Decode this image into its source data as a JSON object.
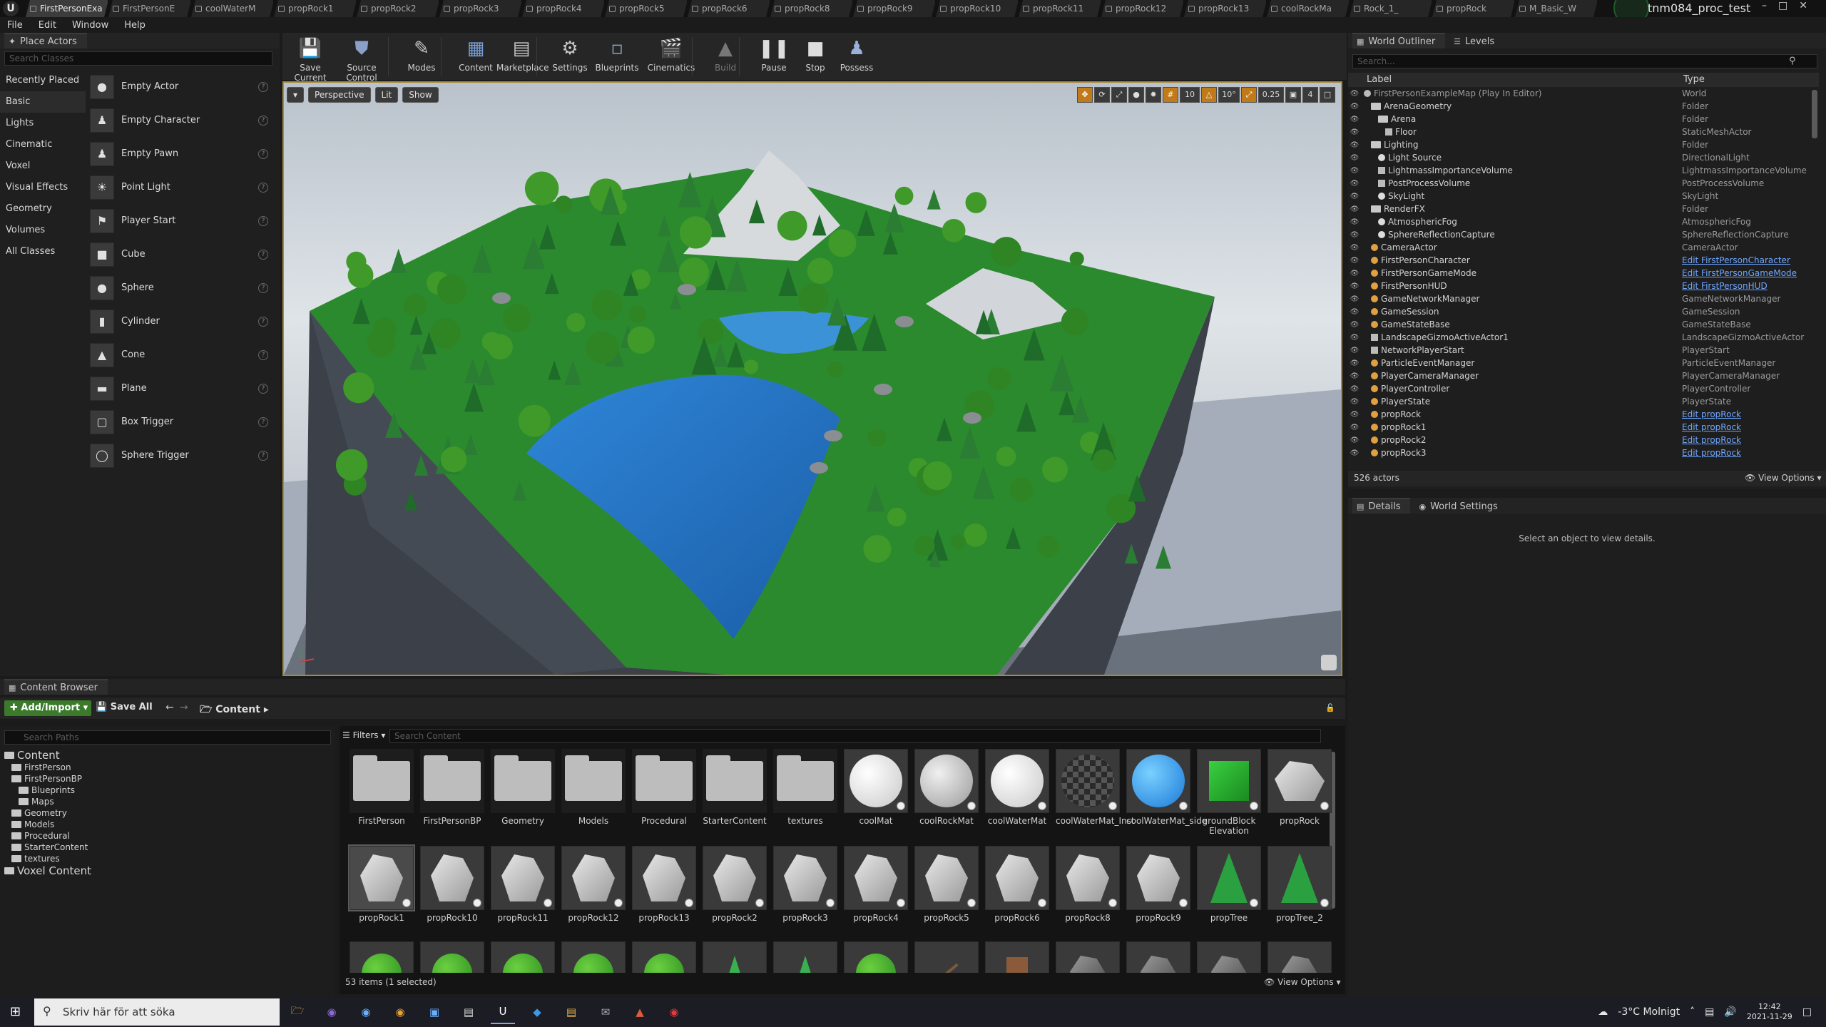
{
  "window": {
    "project": "tnm084_proc_test"
  },
  "tabs": [
    {
      "label": "FirstPersonExa",
      "active": true
    },
    {
      "label": "FirstPersonE"
    },
    {
      "label": "coolWaterM"
    },
    {
      "label": "propRock1"
    },
    {
      "label": "propRock2"
    },
    {
      "label": "propRock3"
    },
    {
      "label": "propRock4"
    },
    {
      "label": "propRock5"
    },
    {
      "label": "propRock6"
    },
    {
      "label": "propRock8"
    },
    {
      "label": "propRock9"
    },
    {
      "label": "propRock10"
    },
    {
      "label": "propRock11"
    },
    {
      "label": "propRock12"
    },
    {
      "label": "propRock13"
    },
    {
      "label": "coolRockMa"
    },
    {
      "label": "Rock_1_"
    },
    {
      "label": "propRock"
    },
    {
      "label": "M_Basic_W"
    }
  ],
  "menu": [
    "File",
    "Edit",
    "Window",
    "Help"
  ],
  "place_actors": {
    "title": "Place Actors",
    "search_placeholder": "Search Classes",
    "categories": [
      "Recently Placed",
      "Basic",
      "Lights",
      "Cinematic",
      "Voxel",
      "Visual Effects",
      "Geometry",
      "Volumes",
      "All Classes"
    ],
    "selected_category": "Basic",
    "actors": [
      "Empty Actor",
      "Empty Character",
      "Empty Pawn",
      "Point Light",
      "Player Start",
      "Cube",
      "Sphere",
      "Cylinder",
      "Cone",
      "Plane",
      "Box Trigger",
      "Sphere Trigger"
    ]
  },
  "toolbar": {
    "buttons": [
      {
        "label": "Save Current",
        "icon": "save-icon"
      },
      {
        "label": "Source Control",
        "icon": "source-control-icon"
      },
      {
        "label": "Modes",
        "icon": "modes-icon"
      },
      {
        "label": "Content",
        "icon": "content-icon"
      },
      {
        "label": "Marketplace",
        "icon": "marketplace-icon"
      },
      {
        "label": "Settings",
        "icon": "settings-icon"
      },
      {
        "label": "Blueprints",
        "icon": "blueprints-icon"
      },
      {
        "label": "Cinematics",
        "icon": "cinematics-icon"
      },
      {
        "label": "Build",
        "icon": "build-icon"
      },
      {
        "label": "Pause",
        "icon": "pause-icon"
      },
      {
        "label": "Stop",
        "icon": "stop-icon"
      },
      {
        "label": "Possess",
        "icon": "possess-icon"
      }
    ]
  },
  "viewport": {
    "view_mode": "Perspective",
    "lit": "Lit",
    "show": "Show",
    "grid_snap": "10",
    "rot_snap": "10°",
    "scale_snap": "0.25",
    "cam_speed": "4"
  },
  "outliner": {
    "title": "World Outliner",
    "levels_tab": "Levels",
    "search_placeholder": "Search...",
    "col_label": "Label",
    "col_type": "Type",
    "rows": [
      {
        "label": "FirstPersonExampleMap (Play In Editor)",
        "type": "World",
        "indent": 0,
        "icon": "world"
      },
      {
        "label": "ArenaGeometry",
        "type": "Folder",
        "indent": 1,
        "icon": "folder"
      },
      {
        "label": "Arena",
        "type": "Folder",
        "indent": 2,
        "icon": "folder"
      },
      {
        "label": "Floor",
        "type": "StaticMeshActor",
        "indent": 3,
        "icon": "mesh"
      },
      {
        "label": "Lighting",
        "type": "Folder",
        "indent": 1,
        "icon": "folder"
      },
      {
        "label": "Light Source",
        "type": "DirectionalLight",
        "indent": 2,
        "icon": "light"
      },
      {
        "label": "LightmassImportanceVolume",
        "type": "LightmassImportanceVolume",
        "indent": 2,
        "icon": "mesh"
      },
      {
        "label": "PostProcessVolume",
        "type": "PostProcessVolume",
        "indent": 2,
        "icon": "mesh"
      },
      {
        "label": "SkyLight",
        "type": "SkyLight",
        "indent": 2,
        "icon": "light"
      },
      {
        "label": "RenderFX",
        "type": "Folder",
        "indent": 1,
        "icon": "folder"
      },
      {
        "label": "AtmosphericFog",
        "type": "AtmosphericFog",
        "indent": 2,
        "icon": "light"
      },
      {
        "label": "SphereReflectionCapture",
        "type": "SphereReflectionCapture",
        "indent": 2,
        "icon": "light"
      },
      {
        "label": "CameraActor",
        "type": "CameraActor",
        "indent": 1,
        "icon": "actor"
      },
      {
        "label": "FirstPersonCharacter",
        "type": "Edit FirstPersonCharacter",
        "indent": 1,
        "icon": "actor",
        "link": true
      },
      {
        "label": "FirstPersonGameMode",
        "type": "Edit FirstPersonGameMode",
        "indent": 1,
        "icon": "actor",
        "link": true
      },
      {
        "label": "FirstPersonHUD",
        "type": "Edit FirstPersonHUD",
        "indent": 1,
        "icon": "actor",
        "link": true
      },
      {
        "label": "GameNetworkManager",
        "type": "GameNetworkManager",
        "indent": 1,
        "icon": "actor"
      },
      {
        "label": "GameSession",
        "type": "GameSession",
        "indent": 1,
        "icon": "actor"
      },
      {
        "label": "GameStateBase",
        "type": "GameStateBase",
        "indent": 1,
        "icon": "actor"
      },
      {
        "label": "LandscapeGizmoActiveActor1",
        "type": "LandscapeGizmoActiveActor",
        "indent": 1,
        "icon": "mesh"
      },
      {
        "label": "NetworkPlayerStart",
        "type": "PlayerStart",
        "indent": 1,
        "icon": "mesh"
      },
      {
        "label": "ParticleEventManager",
        "type": "ParticleEventManager",
        "indent": 1,
        "icon": "actor"
      },
      {
        "label": "PlayerCameraManager",
        "type": "PlayerCameraManager",
        "indent": 1,
        "icon": "actor"
      },
      {
        "label": "PlayerController",
        "type": "PlayerController",
        "indent": 1,
        "icon": "actor"
      },
      {
        "label": "PlayerState",
        "type": "PlayerState",
        "indent": 1,
        "icon": "actor"
      },
      {
        "label": "propRock",
        "type": "Edit propRock",
        "indent": 1,
        "icon": "actor",
        "link": true
      },
      {
        "label": "propRock1",
        "type": "Edit propRock",
        "indent": 1,
        "icon": "actor",
        "link": true
      },
      {
        "label": "propRock2",
        "type": "Edit propRock",
        "indent": 1,
        "icon": "actor",
        "link": true
      },
      {
        "label": "propRock3",
        "type": "Edit propRock",
        "indent": 1,
        "icon": "actor",
        "link": true
      }
    ],
    "count": "526 actors",
    "view_options": "View Options"
  },
  "details": {
    "title": "Details",
    "world_settings": "World Settings",
    "empty_msg": "Select an object to view details."
  },
  "content_browser": {
    "title": "Content Browser",
    "add_import": "Add/Import",
    "save_all": "Save All",
    "path": "Content",
    "search_paths": "Search Paths",
    "filters": "Filters",
    "search_content": "Search Content",
    "tree": [
      {
        "label": "Content",
        "indent": 0,
        "big": true
      },
      {
        "label": "FirstPerson",
        "indent": 1
      },
      {
        "label": "FirstPersonBP",
        "indent": 1
      },
      {
        "label": "Blueprints",
        "indent": 2
      },
      {
        "label": "Maps",
        "indent": 2
      },
      {
        "label": "Geometry",
        "indent": 1
      },
      {
        "label": "Models",
        "indent": 1
      },
      {
        "label": "Procedural",
        "indent": 1
      },
      {
        "label": "StarterContent",
        "indent": 1
      },
      {
        "label": "textures",
        "indent": 1
      },
      {
        "label": "Voxel Content",
        "indent": 0,
        "big": true
      }
    ],
    "row1": [
      {
        "name": "FirstPerson",
        "kind": "folder"
      },
      {
        "name": "FirstPersonBP",
        "kind": "folder"
      },
      {
        "name": "Geometry",
        "kind": "folder"
      },
      {
        "name": "Models",
        "kind": "folder"
      },
      {
        "name": "Procedural",
        "kind": "folder"
      },
      {
        "name": "StarterContent",
        "kind": "folder"
      },
      {
        "name": "textures",
        "kind": "folder"
      },
      {
        "name": "coolMat",
        "kind": "white-ball"
      },
      {
        "name": "coolRockMat",
        "kind": "grey-ball"
      },
      {
        "name": "coolWaterMat",
        "kind": "white-ball"
      },
      {
        "name": "coolWaterMat_Inst",
        "kind": "checker-ball"
      },
      {
        "name": "coolWaterMat_side",
        "kind": "blue-ball"
      },
      {
        "name": "groundBlock Elevation",
        "kind": "green-cube"
      },
      {
        "name": "propRock",
        "kind": "rock-group"
      }
    ],
    "row2": [
      {
        "name": "propRock1",
        "kind": "rock",
        "selected": true
      },
      {
        "name": "propRock10",
        "kind": "rock"
      },
      {
        "name": "propRock11",
        "kind": "rock"
      },
      {
        "name": "propRock12",
        "kind": "rock"
      },
      {
        "name": "propRock13",
        "kind": "rock"
      },
      {
        "name": "propRock2",
        "kind": "rock"
      },
      {
        "name": "propRock3",
        "kind": "rock"
      },
      {
        "name": "propRock4",
        "kind": "rock"
      },
      {
        "name": "propRock5",
        "kind": "rock"
      },
      {
        "name": "propRock6",
        "kind": "rock"
      },
      {
        "name": "propRock8",
        "kind": "rock"
      },
      {
        "name": "propRock9",
        "kind": "rock"
      },
      {
        "name": "propTree",
        "kind": "tree"
      },
      {
        "name": "propTree_2",
        "kind": "tree"
      }
    ],
    "row3": [
      "bush",
      "bush",
      "bush",
      "bush",
      "bush",
      "pine",
      "pine",
      "bush",
      "twig",
      "stump",
      "stone",
      "stone",
      "stone",
      "stone"
    ],
    "status": "53 items (1 selected)",
    "view_options": "View Options"
  },
  "taskbar": {
    "search": "Skriv här för att söka",
    "weather": "-3°C  Molnigt",
    "time": "12:42",
    "date": "2021-11-29"
  },
  "colors": {
    "accent_outline": "#a88a3a",
    "add_button": "#3a7a2a",
    "link": "#6ea6ff"
  }
}
